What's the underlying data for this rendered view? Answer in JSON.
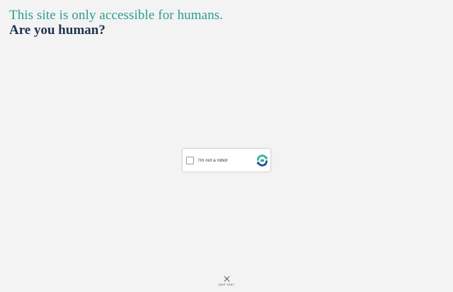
{
  "heading": {
    "line1": "This site is only accessible for humans.",
    "line2": "Are you human?"
  },
  "captcha": {
    "checkbox_label": "I'm not a robot",
    "checked": false,
    "logo_icon": "captcha-logo-icon"
  },
  "skip": {
    "icon": "close-icon",
    "label": "SKIP TEST"
  },
  "colors": {
    "background": "#f3f3f3",
    "heading_teal": "#2a9d8f",
    "heading_navy": "#23344f",
    "logo_teal": "#2ab3a3",
    "logo_blue": "#1e4e8c"
  }
}
